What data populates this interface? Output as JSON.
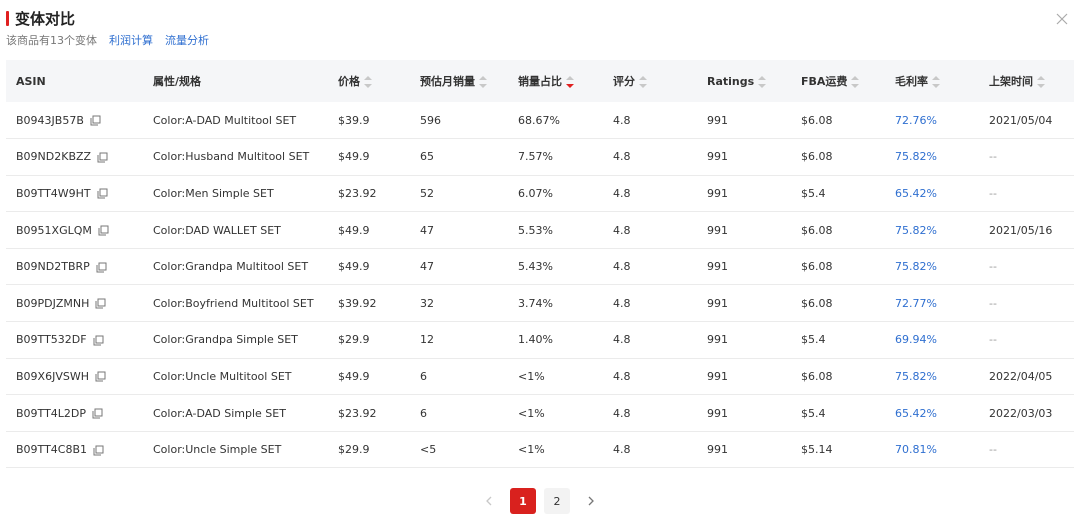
{
  "header": {
    "title": "变体对比",
    "subtitle": "该商品有13个变体",
    "links": [
      "利润计算",
      "流量分析"
    ]
  },
  "table": {
    "columns": [
      "ASIN",
      "属性/规格",
      "价格",
      "预估月销量",
      "销量占比",
      "评分",
      "Ratings",
      "FBA运费",
      "毛利率",
      "上架时间"
    ],
    "rows": [
      [
        "B0943JB57B",
        "Color:A-DAD Multitool SET",
        "$39.9",
        "596",
        "68.67%",
        "4.8",
        "991",
        "$6.08",
        "72.76%",
        "2021/05/04"
      ],
      [
        "B09ND2KBZZ",
        "Color:Husband Multitool SET",
        "$49.9",
        "65",
        "7.57%",
        "4.8",
        "991",
        "$6.08",
        "75.82%",
        "--"
      ],
      [
        "B09TT4W9HT",
        "Color:Men Simple SET",
        "$23.92",
        "52",
        "6.07%",
        "4.8",
        "991",
        "$5.4",
        "65.42%",
        "--"
      ],
      [
        "B0951XGLQM",
        "Color:DAD WALLET SET",
        "$49.9",
        "47",
        "5.53%",
        "4.8",
        "991",
        "$6.08",
        "75.82%",
        "2021/05/16"
      ],
      [
        "B09ND2TBRP",
        "Color:Grandpa Multitool SET",
        "$49.9",
        "47",
        "5.43%",
        "4.8",
        "991",
        "$6.08",
        "75.82%",
        "--"
      ],
      [
        "B09PDJZMNH",
        "Color:Boyfriend Multitool SET",
        "$39.92",
        "32",
        "3.74%",
        "4.8",
        "991",
        "$6.08",
        "72.77%",
        "--"
      ],
      [
        "B09TT532DF",
        "Color:Grandpa Simple SET",
        "$29.9",
        "12",
        "1.40%",
        "4.8",
        "991",
        "$5.4",
        "69.94%",
        "--"
      ],
      [
        "B09X6JVSWH",
        "Color:Uncle Multitool SET",
        "$49.9",
        "6",
        "<1%",
        "4.8",
        "991",
        "$6.08",
        "75.82%",
        "2022/04/05"
      ],
      [
        "B09TT4L2DP",
        "Color:A-DAD Simple SET",
        "$23.92",
        "6",
        "<1%",
        "4.8",
        "991",
        "$5.4",
        "65.42%",
        "2022/03/03"
      ],
      [
        "B09TT4C8B1",
        "Color:Uncle Simple SET",
        "$29.9",
        "<5",
        "<1%",
        "4.8",
        "991",
        "$5.14",
        "70.81%",
        "--"
      ]
    ],
    "sorted_column": "销量占比",
    "sort_direction": "desc"
  },
  "pagination": {
    "pages": [
      "1",
      "2"
    ],
    "current": "1",
    "prev_icon": "chevron-left-icon",
    "next_icon": "chevron-right-icon"
  },
  "colors": {
    "accent": "#e02020",
    "link": "#2f6fd0",
    "header_bg": "#f5f6f8"
  }
}
